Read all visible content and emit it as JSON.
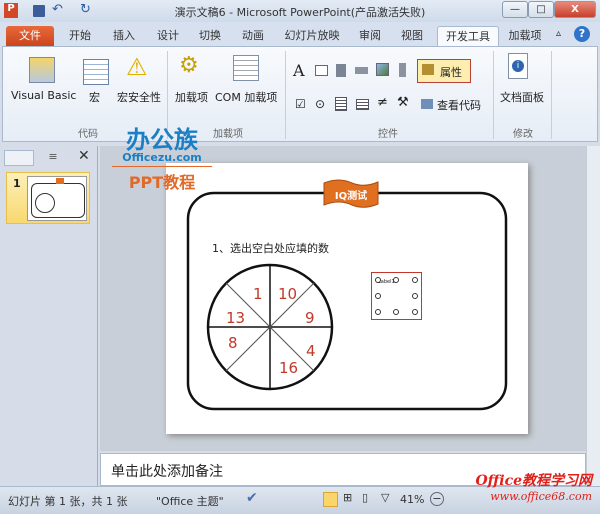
{
  "title_bar": {
    "title": "演示文稿6 - Microsoft PowerPoint(产品激活失败)",
    "minimize": "—",
    "maximize": "□",
    "close": "X"
  },
  "tabs": [
    {
      "label": "文件"
    },
    {
      "label": "开始"
    },
    {
      "label": "插入"
    },
    {
      "label": "设计"
    },
    {
      "label": "切换"
    },
    {
      "label": "动画"
    },
    {
      "label": "幻灯片放映"
    },
    {
      "label": "审阅"
    },
    {
      "label": "视图"
    },
    {
      "label": "开发工具",
      "active": true
    },
    {
      "label": "加载项"
    }
  ],
  "ribbon": {
    "code": {
      "label": "代码",
      "visual_basic": "Visual Basic",
      "macro": "宏",
      "macro_security": "宏安全性"
    },
    "addins": {
      "label": "加载项",
      "addins": "加载项",
      "com_addins": "COM 加载项"
    },
    "controls": {
      "label": "控件",
      "properties": "属性",
      "view_code": "查看代码",
      "label_icon_text": "A"
    },
    "modify": {
      "label": "修改",
      "doc_panel": "文档面板"
    }
  },
  "watermark": {
    "brand": "办公族",
    "site": "Officezu.com",
    "ppt": "PPT教程",
    "bottom_brand": "Office教程学习网",
    "bottom_site": "www.office68.com"
  },
  "left_pane": {
    "slide_number": "1"
  },
  "slide": {
    "badge": "IQ测试",
    "question": "1、选出空白处应填的数",
    "numbers": [
      "1",
      "10",
      "13",
      "9",
      "8",
      "4",
      "16"
    ],
    "control_label": "Label1"
  },
  "notes": {
    "placeholder": "单击此处添加备注"
  },
  "status": {
    "slide_info": "幻灯片 第 1 张，共 1 张",
    "theme": "\"Office 主题\"",
    "zoom": "41%"
  },
  "colors": {
    "file_tab": "#d4502a",
    "numbers": "#c0392b",
    "badge": "#e07020",
    "properties_border": "#c0392b"
  }
}
